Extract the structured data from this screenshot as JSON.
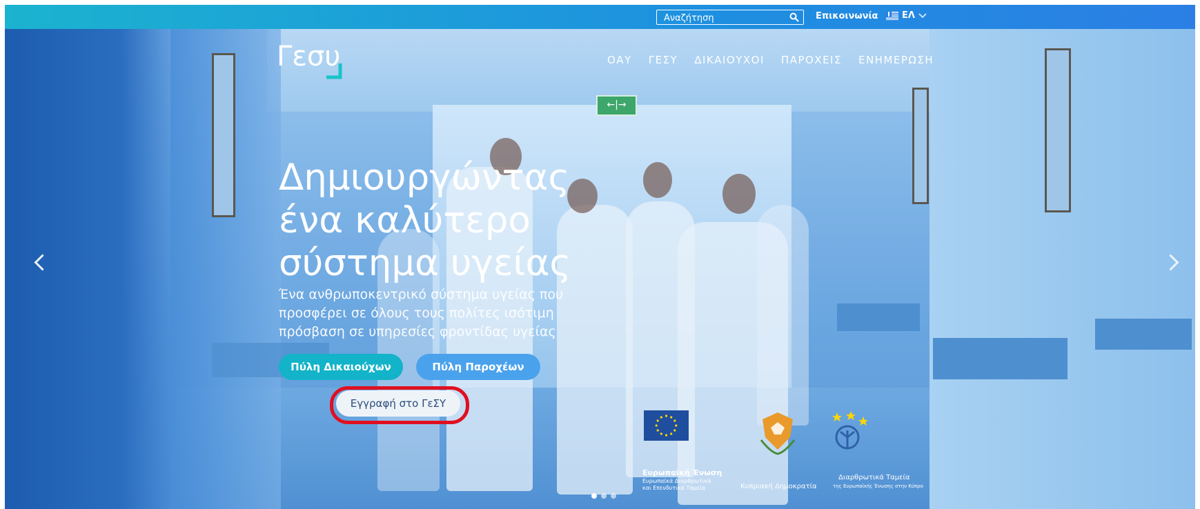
{
  "topbar": {
    "search_placeholder": "Αναζήτηση",
    "contact_label": "Επικοινωνία",
    "language_label": "ΕΛ"
  },
  "logo": {
    "text": "Γεσυ"
  },
  "nav": {
    "items": [
      "ΟΑΥ",
      "ΓΕΣΥ",
      "ΔΙΚΑΙΟΥΧΟΙ",
      "ΠΑΡΟΧΕΙΣ",
      "ΕΝΗΜΕΡΩΣΗ"
    ]
  },
  "hero": {
    "headline_line1": "Δημιουργώντας",
    "headline_line2": "ένα καλύτερο",
    "headline_line3": "σύστημα υγείας",
    "subtitle": "Ένα ανθρωποκεντρικό σύστημα υγείας που προσφέρει σε όλους τους πολίτες ισότιμη πρόσβαση σε υπηρεσίες φροντίδας υγείας",
    "exit_sign": "←|→"
  },
  "buttons": {
    "beneficiaries_portal": "Πύλη Δικαιούχων",
    "providers_portal": "Πύλη Παροχέων",
    "register": "Εγγραφή στο ΓεΣΥ"
  },
  "carousel": {
    "slides": 3,
    "active_slide": 1
  },
  "footer_logos": {
    "eu_title": "Ευρωπαϊκή Ένωση",
    "eu_subtitle": "Ευρωπαϊκά Διαρθρωτικά και Επενδυτικά Ταμεία",
    "cyprus_text": "Κυπριακή Δημοκρατία",
    "structural_funds_title": "Διαρθρωτικά Ταμεία",
    "structural_funds_subtitle": "της Ευρωπαϊκής Ένωσης στην Κύπρο"
  },
  "colors": {
    "topbar_start": "#1bb3cf",
    "topbar_end": "#2b7fe4",
    "btn_beneficiaries": "#13b3c9",
    "btn_providers": "#4aa2ec",
    "highlight_ring": "#e01020"
  }
}
